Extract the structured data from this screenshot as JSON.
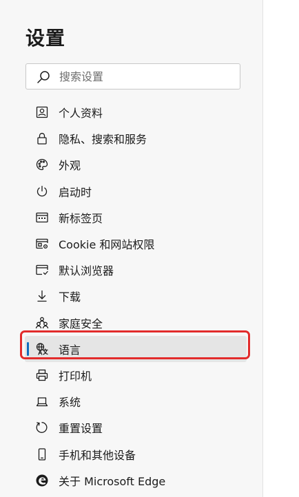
{
  "page": {
    "title": "设置"
  },
  "search": {
    "placeholder": "搜索设置"
  },
  "nav": {
    "items": [
      {
        "label": "个人资料",
        "icon": "profile-icon"
      },
      {
        "label": "隐私、搜索和服务",
        "icon": "lock-icon"
      },
      {
        "label": "外观",
        "icon": "palette-icon"
      },
      {
        "label": "启动时",
        "icon": "power-icon"
      },
      {
        "label": "新标签页",
        "icon": "new-tab-icon"
      },
      {
        "label": "Cookie 和网站权限",
        "icon": "site-permissions-icon"
      },
      {
        "label": "默认浏览器",
        "icon": "default-browser-icon"
      },
      {
        "label": "下载",
        "icon": "download-icon"
      },
      {
        "label": "家庭安全",
        "icon": "family-icon"
      },
      {
        "label": "语言",
        "icon": "language-icon",
        "selected": true
      },
      {
        "label": "打印机",
        "icon": "printer-icon"
      },
      {
        "label": "系统",
        "icon": "system-icon"
      },
      {
        "label": "重置设置",
        "icon": "reset-icon"
      },
      {
        "label": "手机和其他设备",
        "icon": "phone-icon"
      },
      {
        "label": "关于 Microsoft Edge",
        "icon": "edge-logo-icon"
      }
    ]
  },
  "colors": {
    "accent": "#0f6cbd",
    "highlight_box": "#e22b2b",
    "selected_background": "#e5e5e5"
  }
}
